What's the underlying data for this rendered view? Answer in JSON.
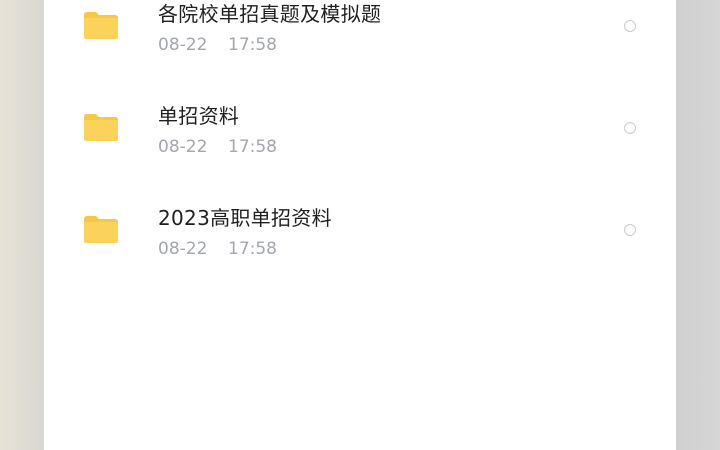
{
  "files": [
    {
      "name": "各院校单招真题及模拟题",
      "date": "08-22",
      "time": "17:58",
      "icon": "folder-icon",
      "selected": false
    },
    {
      "name": "单招资料",
      "date": "08-22",
      "time": "17:58",
      "icon": "folder-icon",
      "selected": false
    },
    {
      "name": "2023高职单招资料",
      "date": "08-22",
      "time": "17:58",
      "icon": "folder-icon",
      "selected": false
    }
  ],
  "colors": {
    "folder": "#fcd35a",
    "folder_tab": "#f7c843",
    "title_text": "#1f1f1f",
    "meta_text": "#a3a6ac",
    "panel_bg": "#ffffff",
    "backdrop": "#d9d9d9"
  }
}
